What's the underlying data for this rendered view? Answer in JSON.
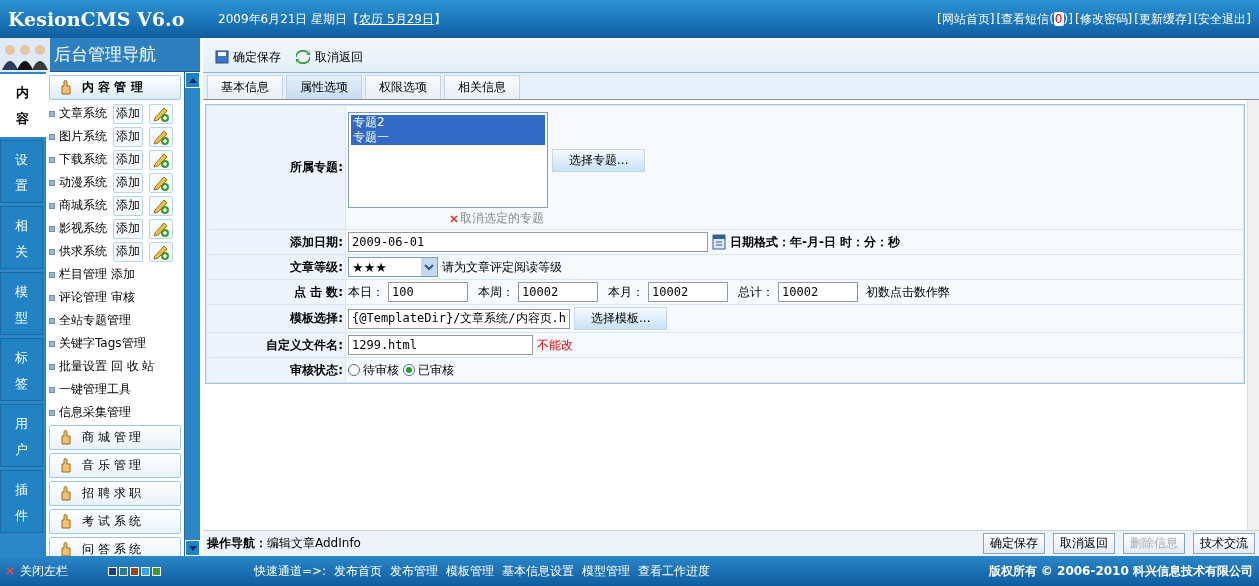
{
  "header": {
    "logo": "KesionCMS V6.o",
    "date": "2009年6月21日 星期日【",
    "lunar": "农历 5月29日",
    "date_end": "】",
    "links": [
      {
        "prefix": "[网站首页]"
      },
      {
        "prefix": "[查看短信(",
        "count": "0",
        "suffix": ")]"
      },
      {
        "prefix": "[修改密码]"
      },
      {
        "prefix": "[更新缓存]"
      },
      {
        "prefix": "[安全退出]"
      }
    ]
  },
  "sidebar": {
    "title": "后台管理导航",
    "tabs": [
      {
        "label": "内容",
        "selected": true
      },
      {
        "label": "设置",
        "selected": false
      },
      {
        "label": "相关",
        "selected": false
      },
      {
        "label": "模型",
        "selected": false
      },
      {
        "label": "标签",
        "selected": false
      },
      {
        "label": "用户",
        "selected": false
      },
      {
        "label": "插件",
        "selected": false
      }
    ],
    "items": [
      {
        "kind": "header",
        "label": "内 容 管 理",
        "selected": true
      },
      {
        "kind": "system",
        "label": "文章系统",
        "action": "添加"
      },
      {
        "kind": "system",
        "label": "图片系统",
        "action": "添加"
      },
      {
        "kind": "system",
        "label": "下载系统",
        "action": "添加"
      },
      {
        "kind": "system",
        "label": "动漫系统",
        "action": "添加"
      },
      {
        "kind": "system",
        "label": "商城系统",
        "action": "添加"
      },
      {
        "kind": "system",
        "label": "影视系统",
        "action": "添加"
      },
      {
        "kind": "system",
        "label": "供求系统",
        "action": "添加"
      },
      {
        "kind": "link",
        "label": "栏目管理 添加"
      },
      {
        "kind": "link",
        "label": "评论管理 审核"
      },
      {
        "kind": "link",
        "label": "全站专题管理"
      },
      {
        "kind": "link",
        "label": "关键字Tags管理"
      },
      {
        "kind": "link",
        "label": "批量设置 回 收 站"
      },
      {
        "kind": "link",
        "label": "一键管理工具"
      },
      {
        "kind": "link",
        "label": "信息采集管理"
      },
      {
        "kind": "header",
        "label": "商 城 管 理",
        "selected": false
      },
      {
        "kind": "header",
        "label": "音 乐 管 理",
        "selected": false
      },
      {
        "kind": "header",
        "label": "招 聘 求 职",
        "selected": false
      },
      {
        "kind": "header",
        "label": "考 试 系 统",
        "selected": false
      },
      {
        "kind": "header",
        "label": "问 答 系 统",
        "selected": false
      }
    ]
  },
  "toolbar": [
    "确定保存",
    "取消返回"
  ],
  "tabs": [
    {
      "label": "基本信息",
      "selected": false
    },
    {
      "label": "属性选项",
      "selected": true
    },
    {
      "label": "权限选项",
      "selected": false
    },
    {
      "label": "相关信息",
      "selected": false
    }
  ],
  "form": [
    {
      "kind": "topics",
      "label": "所属专题:",
      "options": [
        {
          "label": "专题2",
          "selected": true
        },
        {
          "label": "专题一",
          "selected": true
        }
      ],
      "button": "选择专题...",
      "clear": "取消选定的专题"
    },
    {
      "kind": "date",
      "label": "添加日期:",
      "value": "2009-06-01",
      "note": "日期格式：年-月-日 时：分：秒"
    },
    {
      "kind": "select",
      "label": "文章等级:",
      "value": "★★★",
      "note": "请为文章评定阅读等级"
    },
    {
      "kind": "hits",
      "label": "点 击 数:",
      "fields": [
        {
          "label": "本日：",
          "value": "100"
        },
        {
          "label": "本周：",
          "value": "10002"
        },
        {
          "label": "本月：",
          "value": "10002"
        },
        {
          "label": "总计：",
          "value": "10002"
        }
      ],
      "note": "初数点击数作弊"
    },
    {
      "kind": "template",
      "label": "模板选择:",
      "value": "{@TemplateDir}/文章系统/内容页.h",
      "button": "选择模板..."
    },
    {
      "kind": "text",
      "label": "自定义文件名:",
      "value": "1299.html",
      "note": "不能改"
    },
    {
      "kind": "radio",
      "label": "审核状态:",
      "options": [
        {
          "label": "待审核",
          "selected": false
        },
        {
          "label": "已审核",
          "selected": true
        }
      ]
    }
  ],
  "status_bar": {
    "label": "操作导航：",
    "text": "编辑文章AddInfo",
    "buttons": [
      {
        "label": "确定保存",
        "disabled": false
      },
      {
        "label": "取消返回",
        "disabled": false
      },
      {
        "label": "删除信息",
        "disabled": true
      },
      {
        "label": "技术交流",
        "disabled": false
      }
    ]
  },
  "footer": {
    "close": "关闭左栏",
    "swatches": [
      {
        "color": "#1a3f8c"
      },
      {
        "color": "#2f7a8c"
      },
      {
        "color": "#a0421e"
      },
      {
        "color": "#3aa0e0"
      },
      {
        "color": "#3a9a2a"
      }
    ],
    "quick_label": "快速通道=>:",
    "quick_links": [
      "发布首页",
      "发布管理",
      "模板管理",
      "基本信息设置",
      "模型管理",
      "查看工作进度"
    ],
    "copyright": "版权所有 © 2006-2010 科兴信息技术有限公司"
  }
}
